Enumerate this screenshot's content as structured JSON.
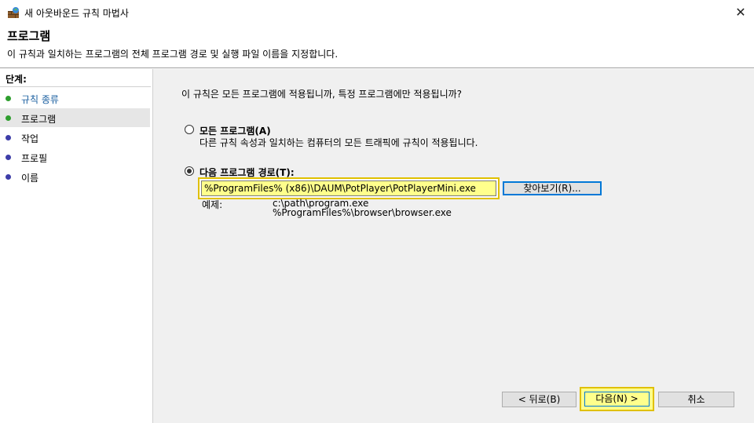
{
  "window": {
    "title": "새 아웃바운드 규칙 마법사",
    "close_glyph": "✕"
  },
  "header": {
    "title": "프로그램",
    "description": "이 규칙과 일치하는 프로그램의 전체 프로그램 경로 및 실행 파일 이름을 지정합니다."
  },
  "sidebar": {
    "title": "단계:",
    "steps": [
      {
        "label": "규칙 종류",
        "status": "done"
      },
      {
        "label": "프로그램",
        "status": "current"
      },
      {
        "label": "작업",
        "status": "pending"
      },
      {
        "label": "프로필",
        "status": "pending"
      },
      {
        "label": "이름",
        "status": "pending"
      }
    ]
  },
  "main": {
    "question": "이 규칙은 모든 프로그램에 적용됩니까, 특정 프로그램에만 적용됩니까?",
    "option_all": {
      "label": "모든 프로그램(A)",
      "description": "다른 규칙 속성과 일치하는 컴퓨터의 모든 트래픽에 규칙이 적용됩니다.",
      "selected": false
    },
    "option_path": {
      "label": "다음 프로그램 경로(T):",
      "selected": true,
      "value": "%ProgramFiles% (x86)\\DAUM\\PotPlayer\\PotPlayerMini.exe"
    },
    "browse_label": "찾아보기(R)...",
    "example_label": "예제:",
    "examples": [
      "c:\\path\\program.exe",
      "%ProgramFiles%\\browser\\browser.exe"
    ]
  },
  "footer": {
    "back_label": "< 뒤로(B)",
    "next_label": "다음(N) >",
    "cancel_label": "취소"
  },
  "colors": {
    "done_dot": "#2e9e2e",
    "pending_dot": "#3d3da8",
    "step_done_text": "#1a5fa0",
    "highlight": "#ffff8c",
    "highlight_border": "#e0c000",
    "focus": "#0078d7"
  }
}
